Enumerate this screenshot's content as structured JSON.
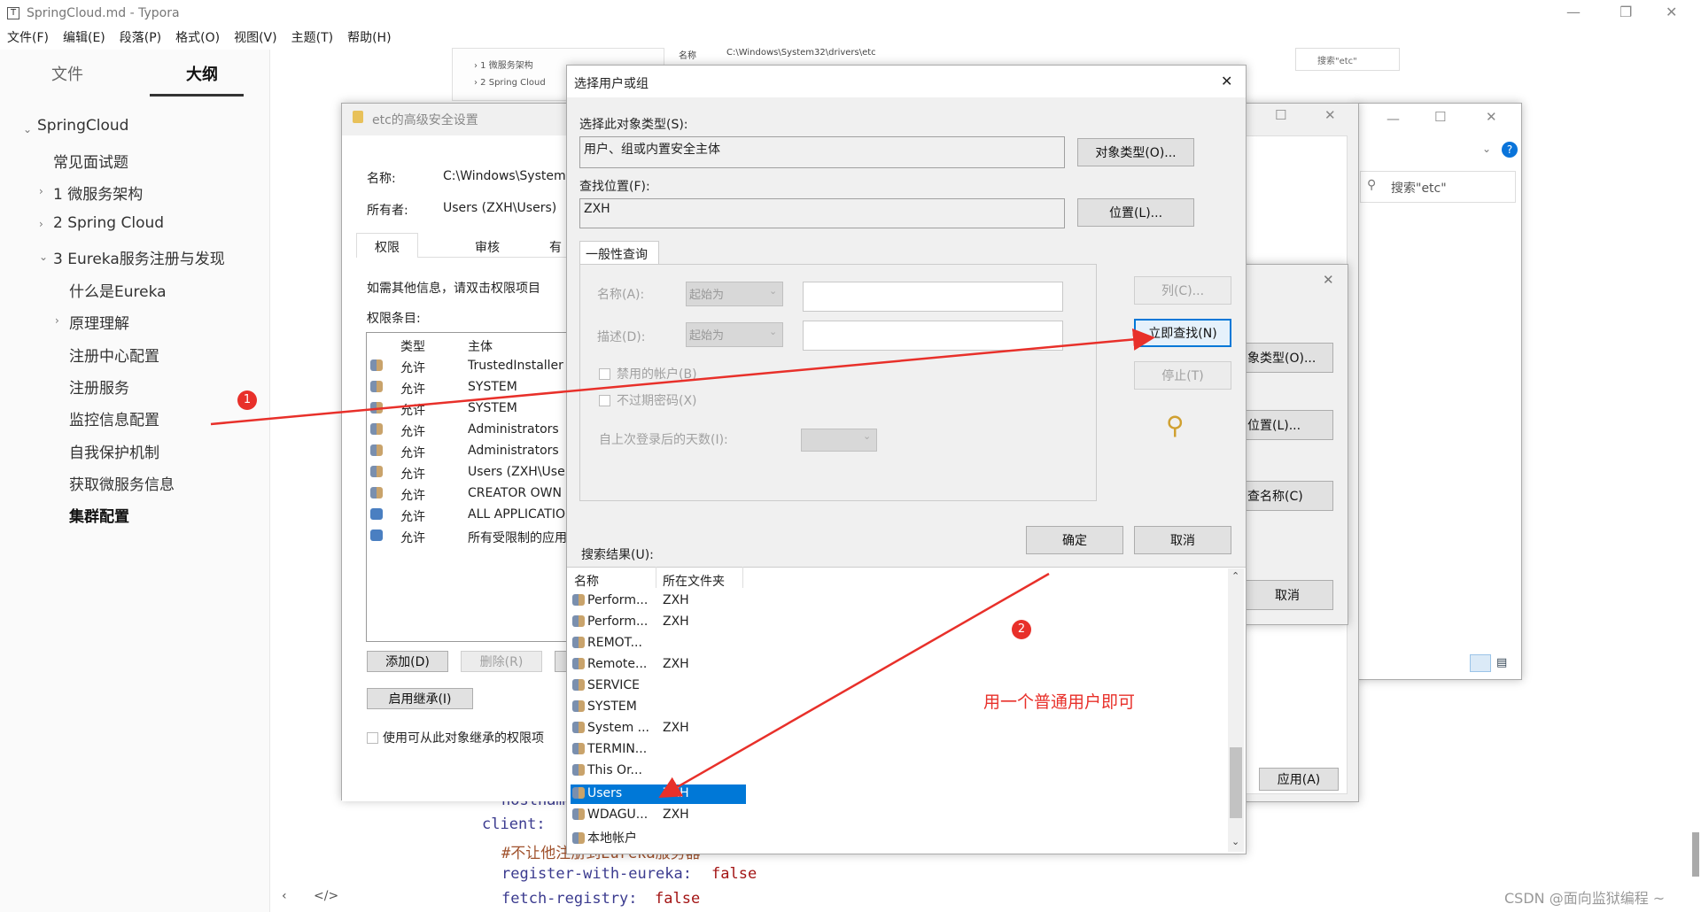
{
  "titlebar": {
    "title": "SpringCloud.md - Typora",
    "app_icon": "T"
  },
  "menu": [
    "文件(F)",
    "编辑(E)",
    "段落(P)",
    "格式(O)",
    "视图(V)",
    "主题(T)",
    "帮助(H)"
  ],
  "sidebar": {
    "tab_files": "文件",
    "tab_outline": "大纲",
    "items": [
      {
        "label": "SpringCloud"
      },
      {
        "label": "常见面试题"
      },
      {
        "label": "1 微服务架构"
      },
      {
        "label": "2 Spring Cloud"
      },
      {
        "label": "3 Eureka服务注册与发现"
      },
      {
        "label": "什么是Eureka"
      },
      {
        "label": "原理理解"
      },
      {
        "label": "注册中心配置"
      },
      {
        "label": "注册服务"
      },
      {
        "label": "监控信息配置"
      },
      {
        "label": "自我保护机制"
      },
      {
        "label": "获取微服务信息"
      },
      {
        "label": "集群配置"
      }
    ]
  },
  "editor": {
    "line1": "hostname",
    "line2": "client:",
    "line3": "#不让他注册到Eureka服务器",
    "line4_key": "register-with-eureka:",
    "line4_val": "false",
    "line5_key": "fetch-registry:",
    "line5_val": "false"
  },
  "bg_doc": {
    "item1": "› 1 微服务架构",
    "item2": "› 2 Spring Cloud",
    "name_label": "名称",
    "path": "C:\\Windows\\System32\\drivers\\etc",
    "search": "搜索\"etc\""
  },
  "explorer": {
    "search": "搜索\"etc\""
  },
  "adv_security": {
    "title": "etc的高级安全设置",
    "name_label": "名称:",
    "name_value": "C:\\Windows\\System",
    "owner_label": "所有者:",
    "owner_value": "Users (ZXH\\Users)",
    "tabs": [
      "权限",
      "审核",
      "有"
    ],
    "info": "如需其他信息，请双击权限项目",
    "entries_label": "权限条目:",
    "col_type": "类型",
    "col_principal": "主体",
    "rows": [
      {
        "type": "允许",
        "principal": "TrustedInstaller"
      },
      {
        "type": "允许",
        "principal": "SYSTEM"
      },
      {
        "type": "允许",
        "principal": "SYSTEM"
      },
      {
        "type": "允许",
        "principal": "Administrators"
      },
      {
        "type": "允许",
        "principal": "Administrators"
      },
      {
        "type": "允许",
        "principal": "Users (ZXH\\Use"
      },
      {
        "type": "允许",
        "principal": "CREATOR OWN"
      },
      {
        "type": "允许",
        "principal": "ALL APPLICATIO"
      },
      {
        "type": "允许",
        "principal": "所有受限制的应用"
      }
    ],
    "add_btn": "添加(D)",
    "remove_btn": "删除(R)",
    "inherit_btn": "启用继承(I)",
    "checkbox_label": "使用可从此对象继承的权限项"
  },
  "behind_dialog": {
    "btn_type": "象类型(O)...",
    "btn_loc": "位置(L)...",
    "btn_check": "查名称(C)",
    "btn_cancel": "取消",
    "btn_apply": "应用(A)"
  },
  "select_dialog": {
    "title": "选择用户或组",
    "obj_type_label": "选择此对象类型(S):",
    "obj_type_value": "用户、组或内置安全主体",
    "obj_type_btn": "对象类型(O)...",
    "location_label": "查找位置(F):",
    "location_value": "ZXH",
    "location_btn": "位置(L)...",
    "tab_general": "一般性查询",
    "name_label": "名称(A):",
    "name_combo": "起始为",
    "desc_label": "描述(D):",
    "desc_combo": "起始为",
    "cols_btn": "列(C)...",
    "find_now_btn": "立即查找(N)",
    "stop_btn": "停止(T)",
    "disabled_accounts": "禁用的帐户(B)",
    "no_expire": "不过期密码(X)",
    "days_label": "自上次登录后的天数(I):",
    "ok_btn": "确定",
    "cancel_btn": "取消",
    "results_label": "搜索结果(U):",
    "col_name": "名称",
    "col_folder": "所在文件夹",
    "results": [
      {
        "name": "Perform...",
        "folder": "ZXH"
      },
      {
        "name": "Perform...",
        "folder": "ZXH"
      },
      {
        "name": "REMOT...",
        "folder": ""
      },
      {
        "name": "Remote...",
        "folder": "ZXH"
      },
      {
        "name": "SERVICE",
        "folder": ""
      },
      {
        "name": "SYSTEM",
        "folder": ""
      },
      {
        "name": "System ...",
        "folder": "ZXH"
      },
      {
        "name": "TERMIN...",
        "folder": ""
      },
      {
        "name": "This Or...",
        "folder": ""
      },
      {
        "name": "Users",
        "folder": "ZXH"
      },
      {
        "name": "WDAGU...",
        "folder": "ZXH"
      },
      {
        "name": "本地帐户",
        "folder": ""
      }
    ]
  },
  "annotations": {
    "marker1": "1",
    "marker2": "2",
    "note": "用一个普通用户即可"
  },
  "watermark": "CSDN @面向监狱编程 ~",
  "colors": {
    "annotation_red": "#e8302a",
    "selection_blue": "#0078d7"
  }
}
